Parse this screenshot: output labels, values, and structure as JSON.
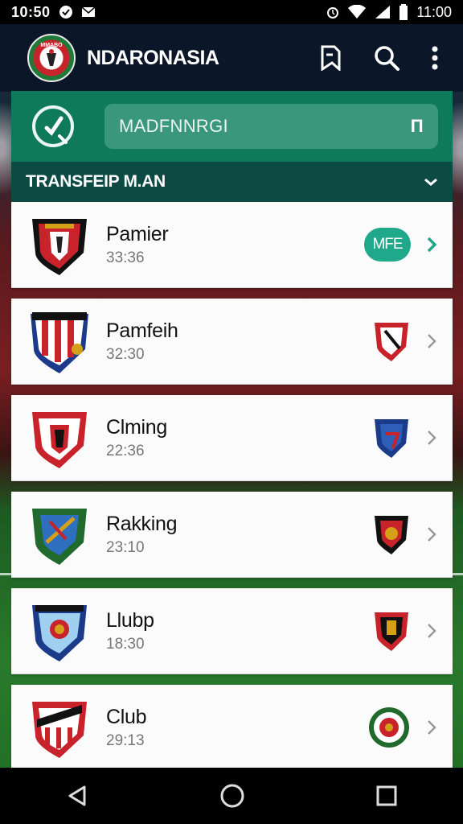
{
  "status_bar": {
    "left_time": "10:50",
    "right_time": "11:00",
    "icons": [
      "circle-check-icon",
      "mail-icon",
      "alarm-icon",
      "wifi-icon",
      "signal-icon",
      "battery-icon"
    ]
  },
  "app_bar": {
    "title": "NDARONASIA",
    "logo_text": "MMABO",
    "icons": [
      "bookmark-icon",
      "search-icon",
      "more-vert-icon"
    ]
  },
  "search": {
    "value": "MADFNNRGI",
    "trailing_symbol": "Π"
  },
  "section": {
    "title": "TRANSFEIP M.AN"
  },
  "rows": [
    {
      "title": "Pamier",
      "sub": "33:36",
      "badge": "MFE"
    },
    {
      "title": "Pamfeih",
      "sub": "32:30",
      "badge": null
    },
    {
      "title": "Clming",
      "sub": "22:36",
      "badge": null
    },
    {
      "title": "Rakking",
      "sub": "23:10",
      "badge": null
    },
    {
      "title": "Llubp",
      "sub": "18:30",
      "badge": null
    },
    {
      "title": "Club",
      "sub": "29:13",
      "badge": null
    }
  ],
  "colors": {
    "accent_green": "#0f7a5a",
    "section_teal": "#0d4a44",
    "pill_green": "#20a88a"
  }
}
